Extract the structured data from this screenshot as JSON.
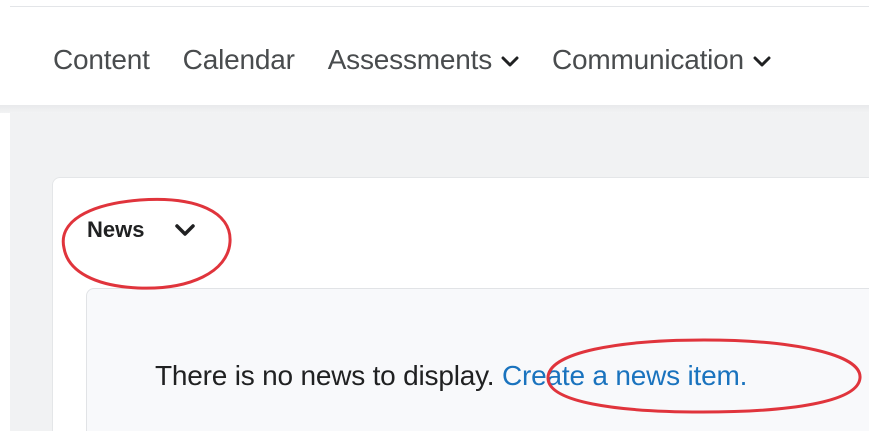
{
  "nav": {
    "items": [
      {
        "label": "Content",
        "has_dropdown": false
      },
      {
        "label": "Calendar",
        "has_dropdown": false
      },
      {
        "label": "Assessments",
        "has_dropdown": true
      },
      {
        "label": "Communication",
        "has_dropdown": true
      }
    ],
    "chevron_icon": "chevron-down-icon"
  },
  "news_widget": {
    "title": "News",
    "menu_icon": "chevron-down-icon",
    "empty_message": "There is no news to display.",
    "create_link": "Create a news item."
  },
  "colors": {
    "link": "#1a73be",
    "annotation": "#e0343c",
    "text": "#202122",
    "nav_text": "#494c4e",
    "page_background": "#f1f2f3"
  }
}
